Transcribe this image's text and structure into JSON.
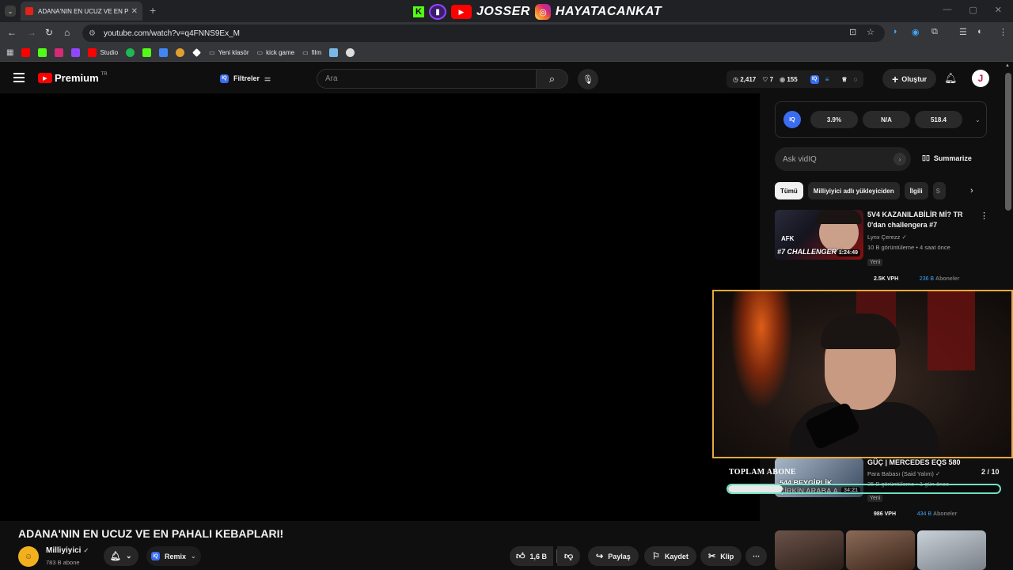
{
  "browser": {
    "tab_title": "ADANA'NIN EN UCUZ VE EN P...",
    "url": "youtube.com/watch?v=q4FNNS9Ex_M",
    "bookmarks": [
      "Studio",
      "Yeni klasör",
      "kick game",
      "film"
    ],
    "stream_overlay_top": {
      "brand": "JOSSER",
      "handle": "HAYATACANKAT"
    }
  },
  "youtube": {
    "logo_text": "Premium",
    "logo_region": "TR",
    "filters_label": "Filtreler",
    "search_placeholder": "Ara",
    "stats": {
      "views": "2,417",
      "likes": "7",
      "watching": "155"
    },
    "create_label": "Oluştur",
    "avatar_letter": "J"
  },
  "vidiq": {
    "badge": "IQ",
    "metrics": [
      "3.9%",
      "N/A",
      "518.4"
    ],
    "ask_placeholder": "Ask vidIQ",
    "summarize_label": "Summarize"
  },
  "chips": [
    "Tümü",
    "Milliyiyici adlı yükleyiciden",
    "İlgili",
    "S"
  ],
  "recommendations": [
    {
      "title_line1": "5V4 KAZANILABİLİR Mİ? TR",
      "title_line2": "0'dan challengera #7",
      "channel": "Lynx Çerezz",
      "views_time": "10 B görüntüleme • 4 saat önce",
      "badge": "Yeni",
      "vph": "2.5K VPH",
      "subs_value": "236 B",
      "subs_label": "Aboneler",
      "duration": "1:24:49",
      "thumb_tag": "AFK",
      "thumb_text": "#7 CHALLENGER'A"
    },
    {
      "title_line1": "GÜÇ | MERCEDES EQS 580",
      "channel": "Para Babası (Said Yalım)",
      "views_time": "35 B görüntüleme • 1 gün önce",
      "badge": "Yeni",
      "vph": "986 VPH",
      "subs_value": "434 B",
      "subs_label": "Aboneler",
      "duration": "34:21",
      "thumb_text_line1": "544 BEYGİRLİK",
      "thumb_text_line2": "ÇİRKİN ARABA A..."
    }
  ],
  "stream_goal": {
    "label": "TOPLAM ABONE",
    "count": "2 / 10",
    "progress": 0.2
  },
  "video": {
    "title": "ADANA'NIN EN UCUZ VE EN PAHALI KEBAPLARI!",
    "channel": "Milliyiyici",
    "subscribers": "783 B abone",
    "remix_label": "Remix",
    "likes": "1,6 B",
    "share_label": "Paylaş",
    "save_label": "Kaydet",
    "clip_label": "Klip"
  }
}
